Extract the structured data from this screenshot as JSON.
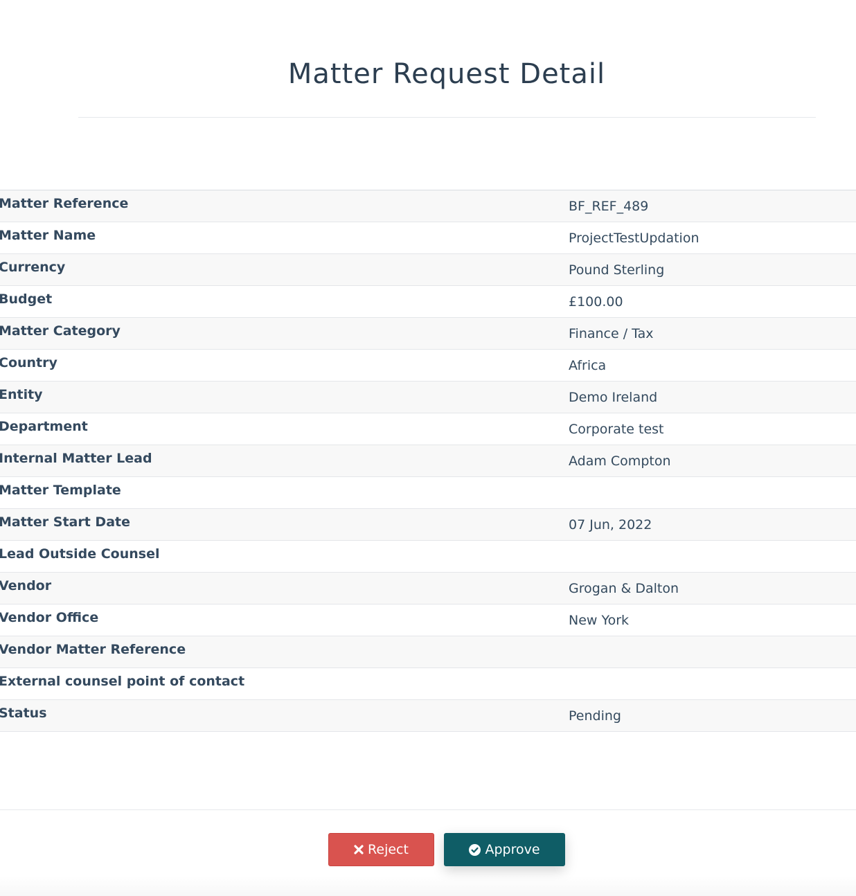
{
  "page": {
    "title": "Matter Request Detail"
  },
  "details": [
    {
      "label": "Matter Reference",
      "value": "BF_REF_489"
    },
    {
      "label": "Matter Name",
      "value": "ProjectTestUpdation"
    },
    {
      "label": "Currency",
      "value": "Pound Sterling"
    },
    {
      "label": "Budget",
      "value": "£100.00"
    },
    {
      "label": "Matter Category",
      "value": "Finance / Tax"
    },
    {
      "label": "Country",
      "value": "Africa"
    },
    {
      "label": "Entity",
      "value": "Demo Ireland"
    },
    {
      "label": "Department",
      "value": "Corporate test"
    },
    {
      "label": "Internal Matter Lead",
      "value": "Adam Compton"
    },
    {
      "label": "Matter Template",
      "value": ""
    },
    {
      "label": "Matter Start Date",
      "value": "07 Jun, 2022"
    },
    {
      "label": "Lead Outside Counsel",
      "value": ""
    },
    {
      "label": "Vendor",
      "value": "Grogan & Dalton"
    },
    {
      "label": "Vendor Office",
      "value": "New York"
    },
    {
      "label": "Vendor Matter Reference",
      "value": ""
    },
    {
      "label": "External counsel point of contact",
      "value": ""
    },
    {
      "label": "Status",
      "value": "Pending"
    }
  ],
  "actions": {
    "reject_label": "Reject",
    "reject_icon": "times-icon",
    "reject_color": "#d9534f",
    "approve_label": "Approve",
    "approve_icon": "check-circle-icon",
    "approve_color": "#0f5d66"
  }
}
